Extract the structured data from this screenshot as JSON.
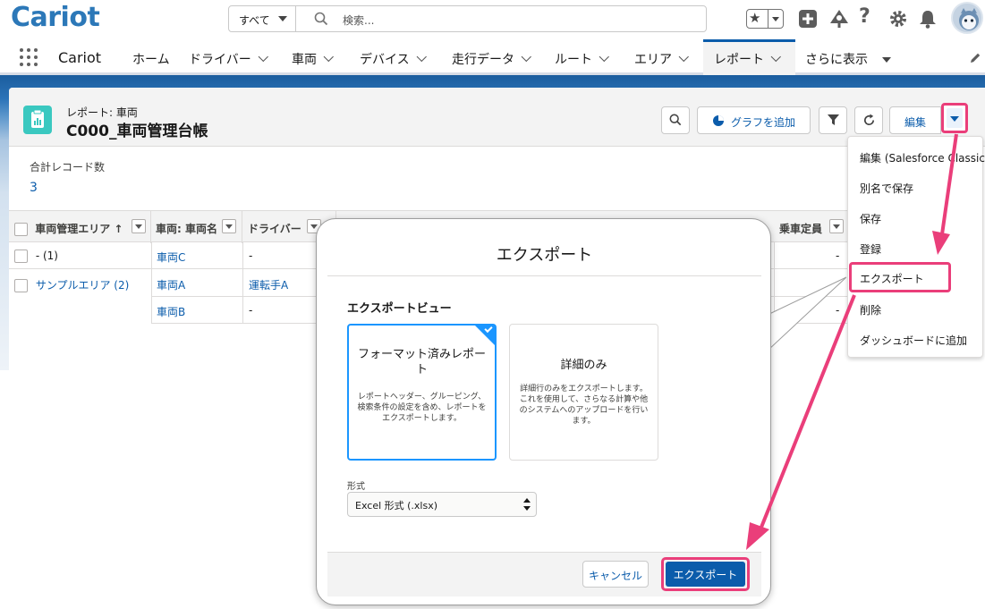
{
  "brand": {
    "logo": "Cariot",
    "app_name": "Cariot"
  },
  "search": {
    "scope": "すべて",
    "placeholder": "検索..."
  },
  "nav": {
    "items": [
      "ホーム",
      "ドライバー",
      "車両",
      "デバイス",
      "走行データ",
      "ルート",
      "エリア",
      "レポート",
      "さらに表示"
    ],
    "active": "レポート"
  },
  "report": {
    "eyebrow": "レポート: 車両",
    "title": "C000_車両管理台帳",
    "total_label": "合計レコード数",
    "total_value": "3"
  },
  "toolbar": {
    "add_chart": "グラフを追加",
    "edit": "編集"
  },
  "table": {
    "headers": [
      "車両管理エリア ↑",
      "車両: 車両名",
      "ドライバー",
      "乗車定員"
    ],
    "rows": [
      {
        "area": "- (1)",
        "vehicle": "車両C",
        "driver": "-",
        "end": "-"
      },
      {
        "area": "サンプルエリア (2)",
        "vehicle": "車両A",
        "driver": "運転手A",
        "end": ""
      },
      {
        "area": "",
        "vehicle": "車両B",
        "driver": "-",
        "end": "-"
      }
    ]
  },
  "menu": {
    "items": [
      "編集 (Salesforce Classic)",
      "別名で保存",
      "保存",
      "登録",
      "エクスポート",
      "削除",
      "ダッシュボードに追加"
    ],
    "highlighted": "エクスポート"
  },
  "modal": {
    "title": "エクスポート",
    "section_title": "エクスポートビュー",
    "options": [
      {
        "title": "フォーマット済みレポート",
        "desc": "レポートヘッダー、グルーピング、検索条件の設定を含め、レポートをエクスポートします。",
        "selected": true
      },
      {
        "title": "詳細のみ",
        "desc": "詳細行のみをエクスポートします。これを使用して、さらなる計算や他のシステムへのアップロードを行います。",
        "selected": false
      }
    ],
    "format_label": "形式",
    "format_value": "Excel 形式 (.xlsx)",
    "cancel": "キャンセル",
    "export": "エクスポート"
  },
  "colors": {
    "brand": "#0b5cab",
    "highlight": "#ea3e7a",
    "report_icon": "#3ac8c0",
    "selection": "#1b96ff"
  },
  "icons": [
    "search-icon",
    "star-icon",
    "add-icon",
    "trailhead-icon",
    "help-icon",
    "gear-icon",
    "bell-icon",
    "refresh-icon",
    "filter-icon",
    "chart-icon",
    "pencil-icon",
    "app-launcher-icon"
  ]
}
